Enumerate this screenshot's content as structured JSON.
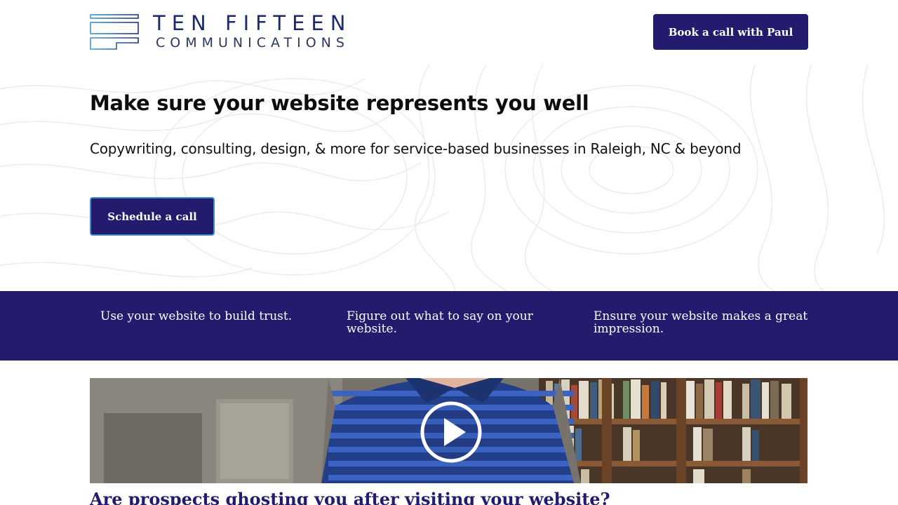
{
  "header": {
    "logo_top": "TEN FIFTEEN",
    "logo_bottom": "COMMUNICATIONS",
    "book_button": "Book a call with Paul"
  },
  "hero": {
    "title": "Make sure your website represents you well",
    "subtitle": "Copywriting, consulting, design, & more for service-based businesses in Raleigh, NC & beyond",
    "cta": "Schedule a call"
  },
  "band": {
    "items": [
      "Use your website to build trust.",
      "Figure out what to say on your website.",
      "Ensure your website makes a great impression."
    ]
  },
  "video": {
    "question": "Are prospects ghosting you after visiting your website?"
  },
  "colors": {
    "brand_navy": "#231c6e",
    "button_border": "#3f8fc4",
    "logo_teal": "#2a7fa8"
  }
}
